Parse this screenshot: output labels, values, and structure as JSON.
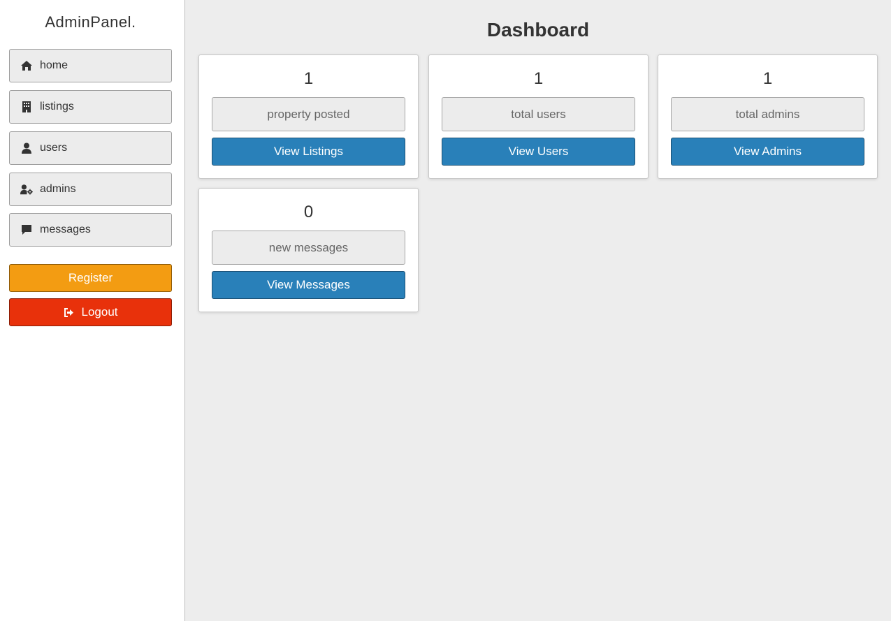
{
  "sidebar": {
    "brand": "AdminPanel.",
    "items": [
      {
        "label": "home",
        "icon": "home-icon"
      },
      {
        "label": "listings",
        "icon": "building-icon"
      },
      {
        "label": "users",
        "icon": "user-icon"
      },
      {
        "label": "admins",
        "icon": "user-gear-icon"
      },
      {
        "label": "messages",
        "icon": "comment-icon"
      }
    ],
    "register_label": "Register",
    "logout_label": "Logout",
    "logout_icon": "sign-out-icon"
  },
  "main": {
    "title": "Dashboard",
    "cards": [
      {
        "count": "1",
        "label": "property posted",
        "button": "View Listings"
      },
      {
        "count": "1",
        "label": "total users",
        "button": "View Users"
      },
      {
        "count": "1",
        "label": "total admins",
        "button": "View Admins"
      },
      {
        "count": "0",
        "label": "new messages",
        "button": "View Messages"
      }
    ]
  },
  "colors": {
    "sidebar_bg": "#ffffff",
    "main_bg": "#ededed",
    "primary_button": "#2980b9",
    "register_button": "#f39c12",
    "logout_button": "#e8310b"
  }
}
